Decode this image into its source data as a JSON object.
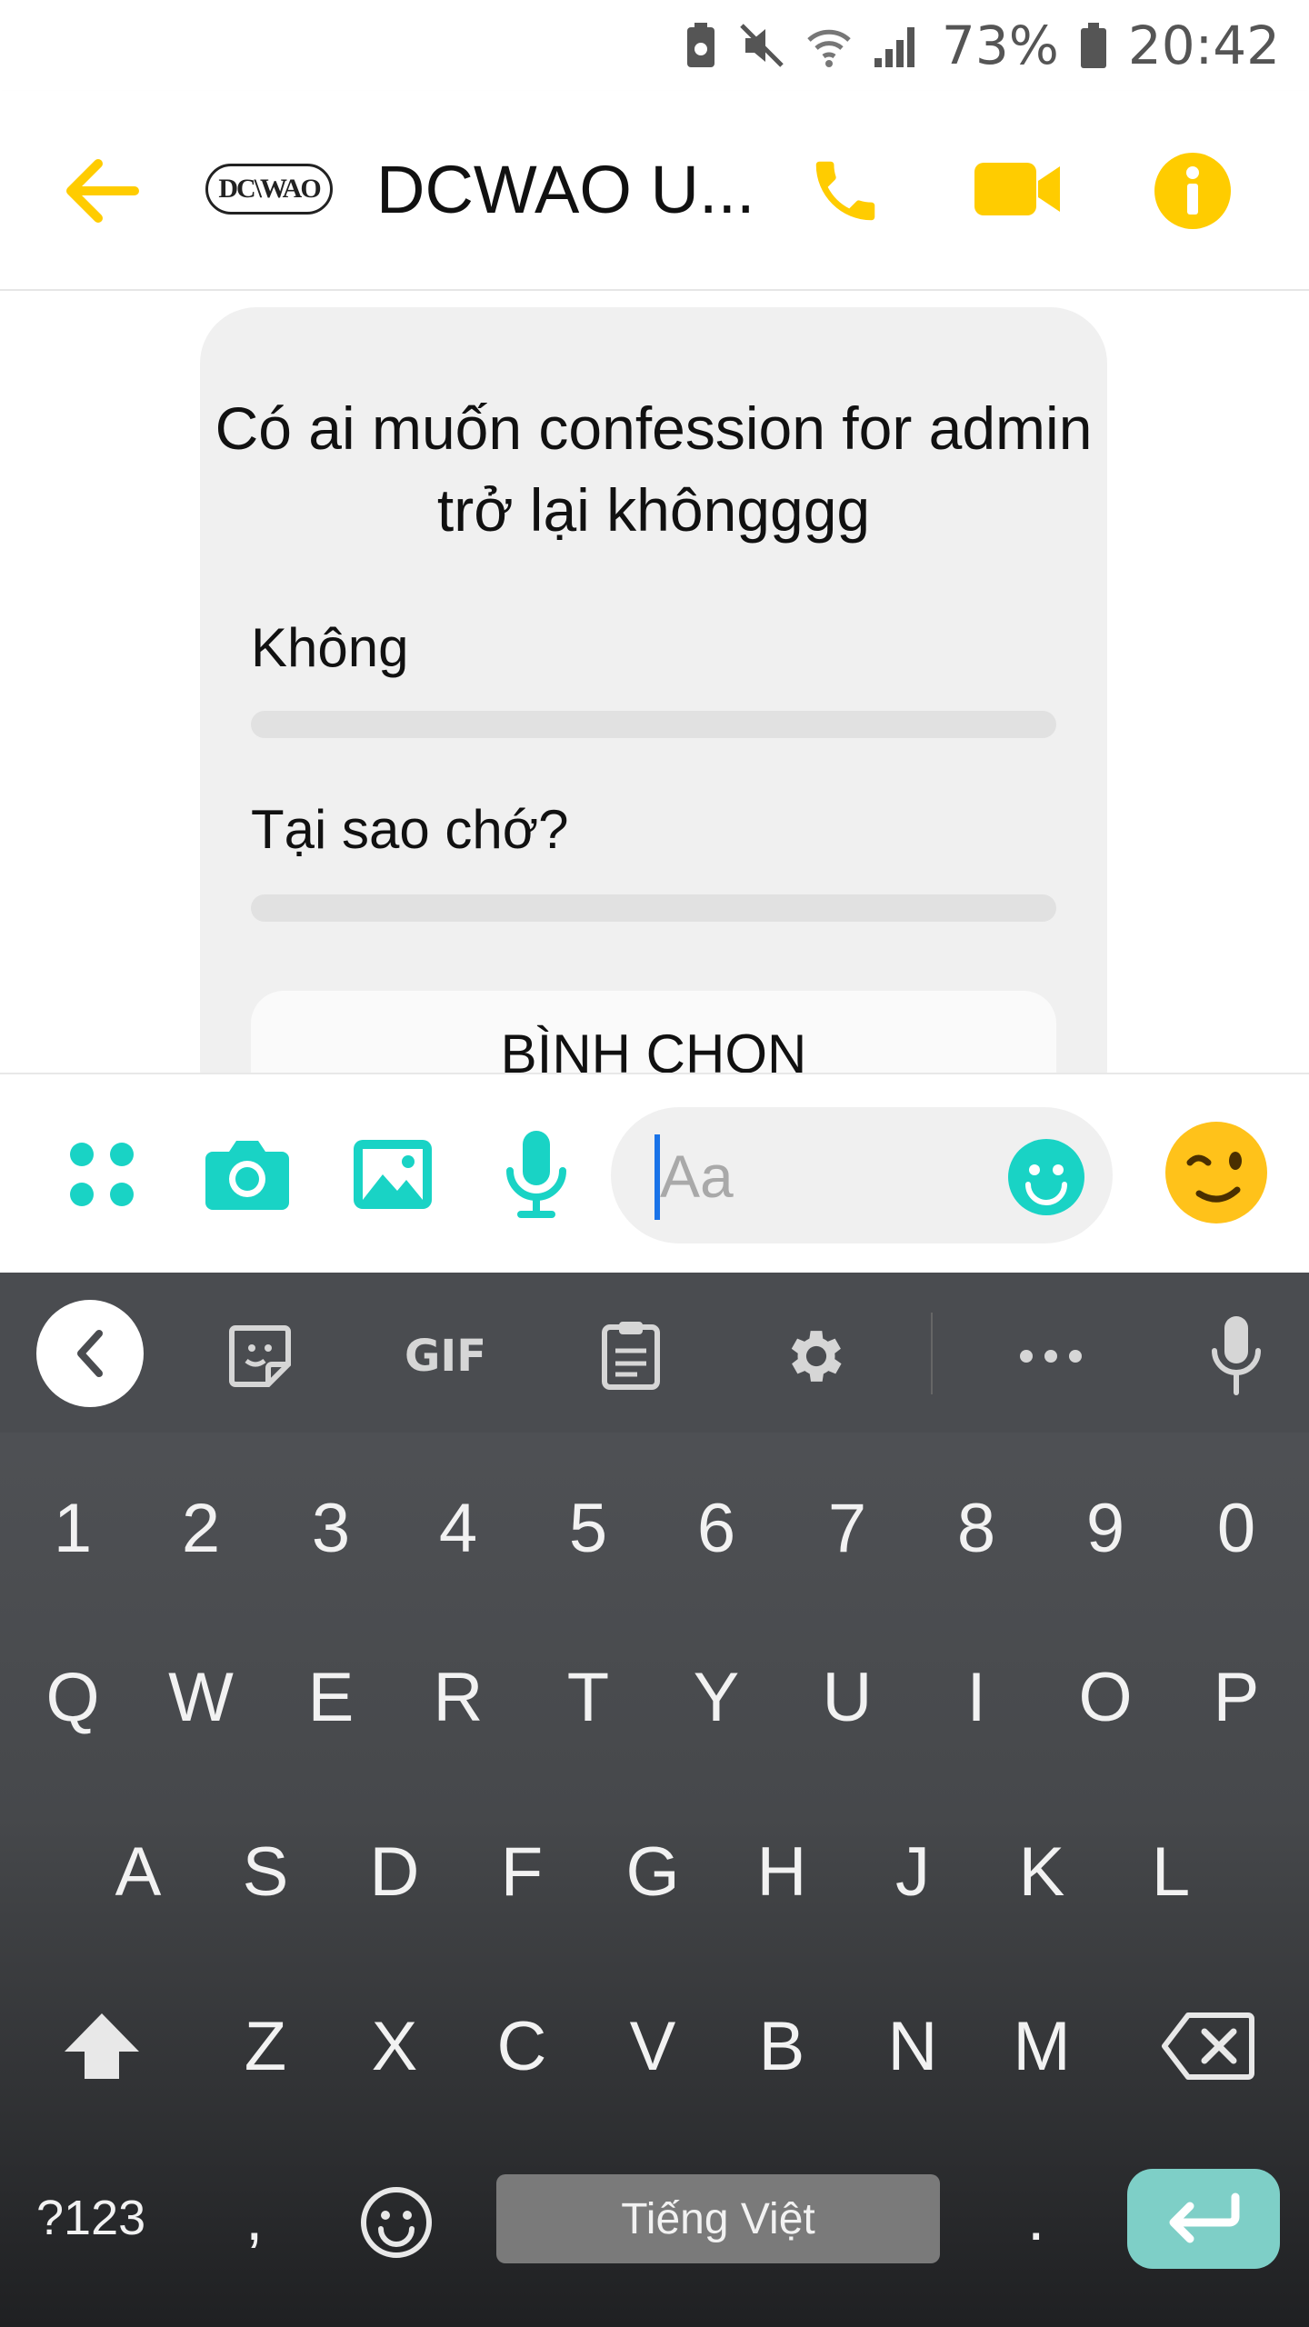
{
  "status_bar": {
    "battery": "73%",
    "time": "20:42"
  },
  "header": {
    "title": "DCWAO U...",
    "logo_text": "DC\\WAO"
  },
  "poll": {
    "question": "Có ai muốn confession for admin trở lại khôngggg",
    "options": [
      {
        "label": "Không",
        "votes_fraction": 0
      },
      {
        "label": "Tại sao chớ?",
        "votes_fraction": 0
      }
    ],
    "vote_button": "BÌNH CHỌN"
  },
  "composer": {
    "placeholder": "Aa"
  },
  "keyboard": {
    "toolbar_gif": "GIF",
    "numbers": [
      "1",
      "2",
      "3",
      "4",
      "5",
      "6",
      "7",
      "8",
      "9",
      "0"
    ],
    "row1": [
      "Q",
      "W",
      "E",
      "R",
      "T",
      "Y",
      "U",
      "I",
      "O",
      "P"
    ],
    "row2": [
      "A",
      "S",
      "D",
      "F",
      "G",
      "H",
      "J",
      "K",
      "L"
    ],
    "row3": [
      "Z",
      "X",
      "C",
      "V",
      "B",
      "N",
      "M"
    ],
    "symbols_key": "?123",
    "comma": ",",
    "space_label": "Tiếng Việt",
    "period": "."
  },
  "colors": {
    "accent": "#ffcc00",
    "teal": "#19d3c5",
    "keyboard_bg": "#4a4c50"
  }
}
